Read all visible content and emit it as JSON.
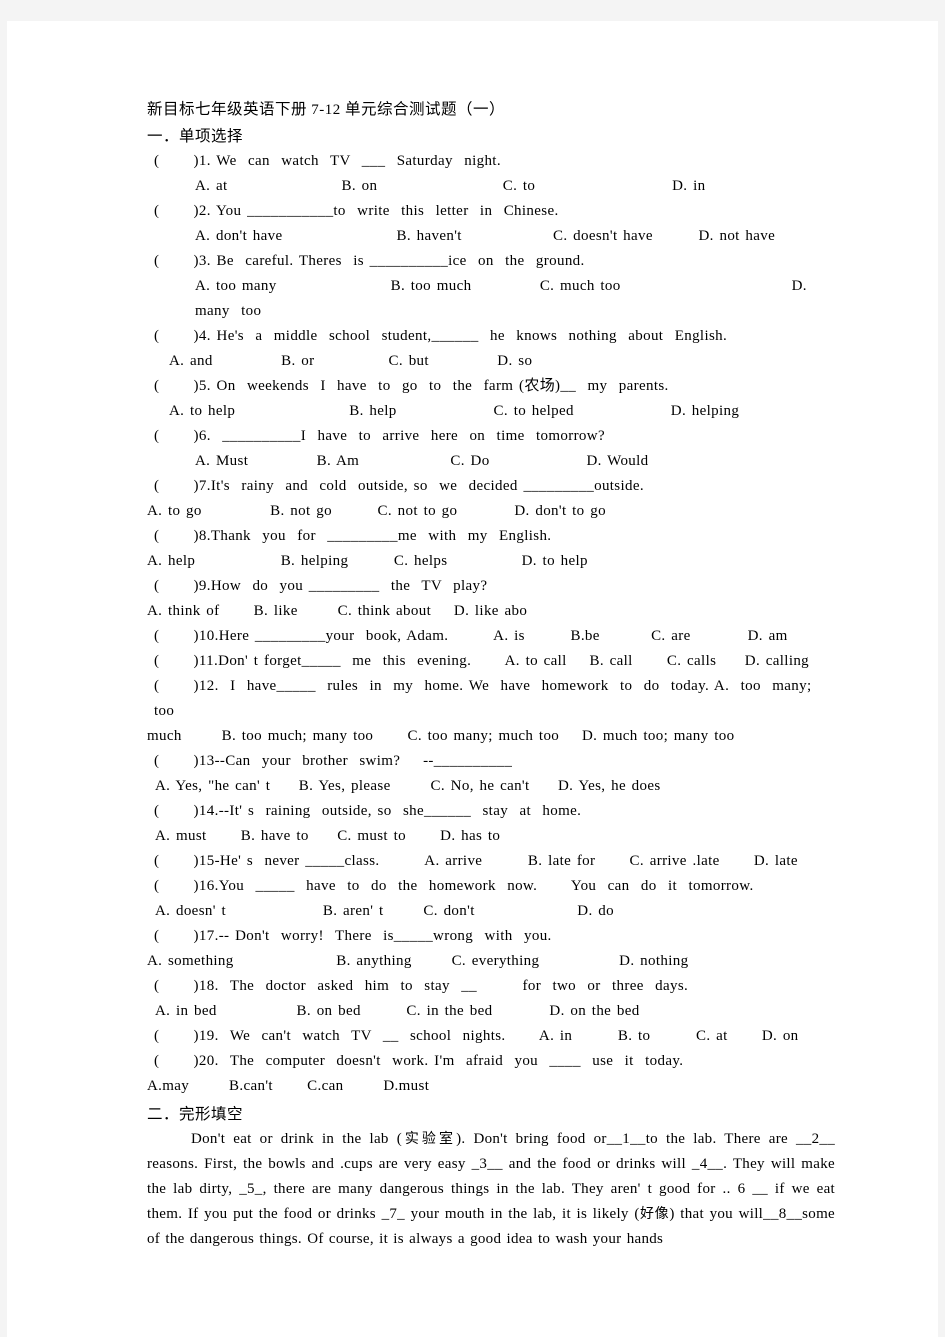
{
  "document": {
    "title_cn_1": "新目标七年级英语下册",
    "title_num": " 7-12 ",
    "title_cn_2": "单元综合测试题（一）",
    "section_1_heading": "一．单项选择",
    "section_2_heading": "二．完形填空"
  },
  "section1": {
    "questions": [
      {
        "stem": "(      )1. We  can  watch  TV  ___  Saturday  night.",
        "options_lines": [
          {
            "text": "A. at                    B. on                      C. to                        D. in",
            "indent": "opt-a"
          }
        ]
      },
      {
        "stem": "(      )2. You ___________to  write  this  letter  in  Chinese.",
        "options_lines": [
          {
            "text": "A. don't have                    B. haven't                C. doesn't have        D. not have",
            "indent": "opt-a"
          }
        ]
      },
      {
        "stem": "(      )3. Be  careful. Theres  is __________ice  on  the  ground.",
        "options_lines": [
          {
            "text": "A. too many                    B. too much            C. much too                              D. many  too",
            "indent": "opt-a"
          }
        ]
      },
      {
        "stem": "(      )4. He's  a  middle  school  student,______  he  knows  nothing  about  English.",
        "options_lines": [
          {
            "text": "A. and            B. or             C. but            D. so",
            "indent": "opt-c"
          }
        ]
      },
      {
        "stem": "(      )5. On  weekends  I  have  to  go  to  the  farm (农场)__  my  parents.",
        "options_lines": [
          {
            "text": "A. to help                    B. help                 C. to helped                 D. helping",
            "indent": "opt-c"
          }
        ]
      },
      {
        "stem": "(      )6.  __________I  have  to  arrive  here  on  time  tomorrow?",
        "options_lines": [
          {
            "text": "A. Must            B. Am                C. Do                 D. Would",
            "indent": "opt-a"
          }
        ]
      },
      {
        "stem": "(      )7.It's  rainy  and  cold  outside, so  we  decided _________outside.",
        "options_lines": [
          {
            "text": "A. to go            B. not go        C. not to go          D. don't to go",
            "indent": "opt-e"
          }
        ]
      },
      {
        "stem": "(      )8.Thank  you  for  _________me  with  my  English.",
        "options_lines": [
          {
            "text": "A. help               B. helping        C. helps             D. to help",
            "indent": "opt-e"
          }
        ]
      },
      {
        "stem": "(      )9.How  do  you _________  the  TV  play?",
        "options_lines": [
          {
            "text": "A. think of      B. like       C. think about    D. like abo",
            "indent": "opt-e"
          }
        ]
      },
      {
        "stem": "(      )10.Here _________your  book, Adam.        A. is        B.be         C. are          D. am",
        "options_lines": []
      },
      {
        "stem": "(      )11.Don' t forget_____  me  this  evening.      A. to call    B. call      C. calls     D. calling",
        "options_lines": []
      },
      {
        "stem": "(      )12.  I  have_____  rules  in  my  home. We  have  homework  to  do  today. A.  too  many;  too",
        "options_lines": [
          {
            "text": "much       B. too much; many too      C. too many; much too    D. much too; many too",
            "indent": "opt-e"
          }
        ]
      },
      {
        "stem": "(      )13--Can  your  brother  swim?    --__________",
        "options_lines": [
          {
            "text": "A. Yes, \"he can' t     B. Yes, please       C. No, he can't     D. Yes, he does",
            "indent": "opt-d"
          }
        ]
      },
      {
        "stem": "(      )14.--It' s  raining  outside, so  she______  stay  at  home.",
        "options_lines": [
          {
            "text": "A. must      B. have to     C. must to      D. has to",
            "indent": "opt-d"
          }
        ]
      },
      {
        "stem": "(      )15-He' s  never _____class.        A. arrive        B. late for      C. arrive .late      D. late",
        "options_lines": []
      },
      {
        "stem": "(      )16.You  _____  have  to  do  the  homework  now.      You  can  do  it  tomorrow.",
        "options_lines": [
          {
            "text": "A. doesn' t                 B. aren' t       C. don't                  D. do",
            "indent": "opt-d"
          }
        ]
      },
      {
        "stem": "(      )17.-- Don't  worry!  There  is_____wrong  with  you.",
        "options_lines": [
          {
            "text": "A. something                  B. anything       C. everything              D. nothing",
            "indent": "opt-e"
          }
        ]
      },
      {
        "stem": "(      )18.  The  doctor  asked  him  to  stay  __        for  two  or  three  days.",
        "options_lines": [
          {
            "text": "A. in bed              B. on bed        C. in the bed          D. on the bed",
            "indent": "opt-d"
          }
        ]
      },
      {
        "stem": "(      )19.  We  can't  watch  TV  __  school  nights.      A. in        B. to        C. at      D. on",
        "options_lines": []
      },
      {
        "stem": "(      )20.  The  computer  doesn't  work. I'm  afraid  you  ____  use  it  today.",
        "options_lines": [
          {
            "text": "A.may       B.can't      C.can       D.must",
            "indent": "opt-e"
          }
        ]
      }
    ]
  },
  "section2": {
    "passage_parts": [
      {
        "t": "Don't  eat  or  drink  in  the  lab  (",
        "cn": false
      },
      {
        "t": "实验室",
        "cn": true
      },
      {
        "t": "). Don't  bring  food  or__1__to  the  lab. There  are __2__ reasons. First, the  bowls  and  .cups  are  very  easy  _3__  and  the  food  or  drinks  will  _4__. They  will  make  the  lab  dirty,  _5_, there  are  many  dangerous  things  in  the  lab. They  aren' t  good  for  .. 6 __ if  we  eat  them. If  you  put  the  food  or  drinks  _7_  your  mouth  in  the  lab, it  is  likely  (",
        "cn": false
      },
      {
        "t": "好像",
        "cn": true
      },
      {
        "t": ") that  you  will__8__some  of  the  dangerous  things. Of  course, it  is  always  a  good  idea  to  wash  your  hands",
        "cn": false
      }
    ]
  }
}
